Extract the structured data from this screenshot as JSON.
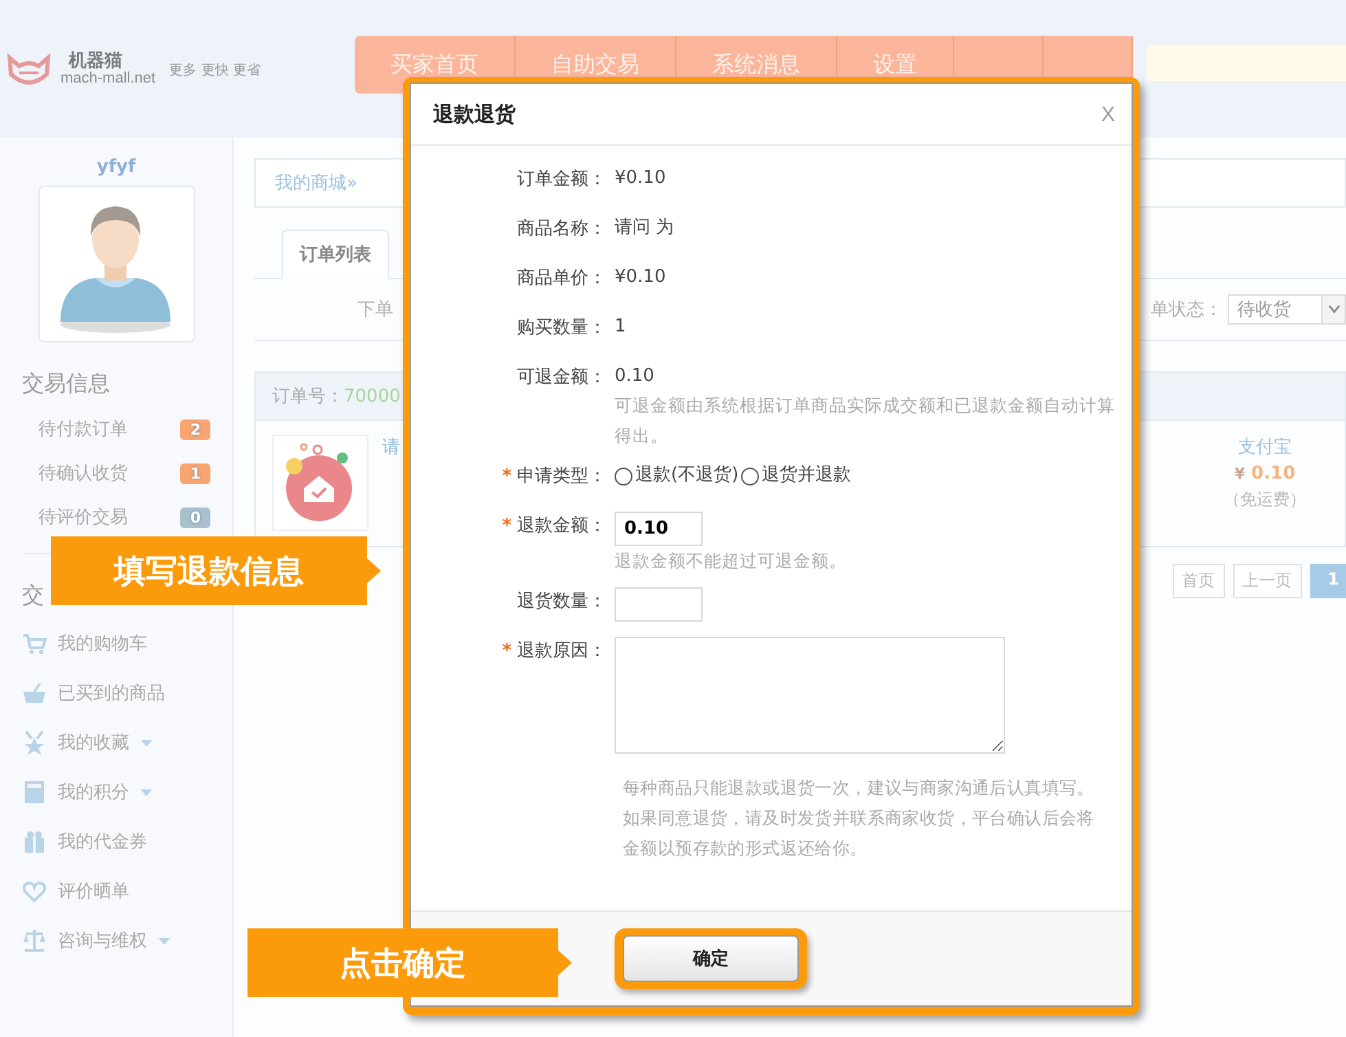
{
  "header": {
    "logo_name": "机器猫",
    "logo_domain": "mach-mall.net",
    "slogan": "更多 更快 更省",
    "nav": [
      {
        "label": "买家首页"
      },
      {
        "label": "自助交易"
      },
      {
        "label": "系统消息"
      },
      {
        "label": "设置"
      }
    ]
  },
  "sidebar": {
    "username": "yfyf",
    "section_title": "交易信息",
    "trade_items": [
      {
        "label": "待付款订单",
        "count": "2",
        "color": "#f9a571"
      },
      {
        "label": "待确认收货",
        "count": "1",
        "color": "#f9a571"
      },
      {
        "label": "待评价交易",
        "count": "0",
        "color": "#a9c0ce"
      }
    ],
    "section2_title": "交",
    "menu": [
      {
        "label": "我的购物车",
        "dropdown": false
      },
      {
        "label": "已买到的商品",
        "dropdown": false
      },
      {
        "label": "我的收藏",
        "dropdown": true
      },
      {
        "label": "我的积分",
        "dropdown": true
      },
      {
        "label": "我的代金券",
        "dropdown": false
      },
      {
        "label": "评价晒单",
        "dropdown": false
      },
      {
        "label": "咨询与维权",
        "dropdown": true
      }
    ]
  },
  "main": {
    "breadcrumb": "我的商城»",
    "tabs": [
      {
        "label": "订单列表",
        "selected": true
      }
    ],
    "filter_label": "下单",
    "status_label": "单状态：",
    "status_value": "待收货",
    "order_no_label": "订单号：",
    "order_no": "70000",
    "item_name": "请",
    "payment": "支付宝",
    "currency": "¥",
    "price": "0.10",
    "shipping": "（免运费）",
    "pagination": [
      {
        "label": "首页",
        "selected": false
      },
      {
        "label": "上一页",
        "selected": false
      },
      {
        "label": "1",
        "selected": true
      }
    ]
  },
  "dialog": {
    "title": "退款退货",
    "close": "X",
    "required_mark": "*",
    "info": [
      {
        "label": "订单金额：",
        "value": "¥0.10"
      },
      {
        "label": "商品名称：",
        "value": "请问 为"
      },
      {
        "label": "商品单价：",
        "value": "¥0.10"
      },
      {
        "label": "购买数量：",
        "value": "1"
      },
      {
        "label": "可退金额：",
        "value": "0.10",
        "note": "可退金额由系统根据订单商品实际成交额和已退款金额自动计算得出。"
      }
    ],
    "type": {
      "label": "申请类型：",
      "required": true,
      "options": [
        {
          "label": "退款(不退货)",
          "selected": false
        },
        {
          "label": "退货并退款",
          "selected": false
        }
      ]
    },
    "amount": {
      "label": "退款金额：",
      "required": true,
      "value": "0.10",
      "note": "退款金额不能超过可退金额。"
    },
    "quantity": {
      "label": "退货数量：",
      "required": false
    },
    "reason": {
      "label": "退款原因：",
      "required": true
    },
    "notes": [
      "每种商品只能退款或退货一次，建议与商家沟通后认真填写。",
      "如果同意退货，请及时发货并联系商家收货，平台确认后会将",
      "金额以预存款的形式返还给你。"
    ],
    "confirm": "确定"
  },
  "callouts": [
    {
      "text": "填写退款信息"
    },
    {
      "text": "点击确定"
    }
  ]
}
